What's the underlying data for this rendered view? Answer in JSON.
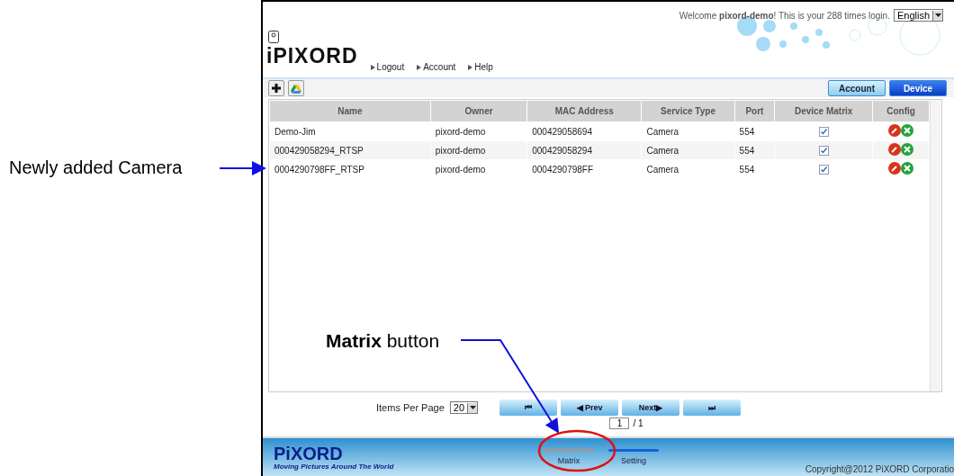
{
  "header": {
    "logo": "iPIXORD",
    "welcome": "Welcome **pixord-demo**! This is your 288 times login.",
    "language": "English",
    "nav_links": [
      "Logout",
      "Account",
      "Help"
    ]
  },
  "toolbar": {
    "tabs": [
      {
        "label": "Account",
        "selected": false
      },
      {
        "label": "Device",
        "selected": true
      }
    ]
  },
  "table": {
    "columns": [
      "Name",
      "Owner",
      "MAC Address",
      "Service Type",
      "Port",
      "Device Matrix",
      "Config"
    ],
    "rows": [
      {
        "cells": [
          "Demo-Jim",
          "pixord-demo",
          "000429058694",
          "Camera",
          "554"
        ],
        "matrix_checked": true
      },
      {
        "cells": [
          "000429058294_RTSP",
          "pixord-demo",
          "000429058294",
          "Camera",
          "554"
        ],
        "matrix_checked": true
      },
      {
        "cells": [
          "0004290798FF_RTSP",
          "pixord-demo",
          "0004290798FF",
          "Camera",
          "554"
        ],
        "matrix_checked": true
      }
    ]
  },
  "pagination": {
    "label": "Items Per Page",
    "per_page": "20",
    "first": "⏮",
    "prev": "◀ Prev",
    "next": "Next▶",
    "last": "⏭",
    "page": "1",
    "total": "/ 1"
  },
  "footer": {
    "logo": "PiXORD",
    "tagline": "Moving Pictures Around The World",
    "tabs": [
      {
        "label": "Matrix",
        "selected": false
      },
      {
        "label": "Setting",
        "selected": true
      }
    ],
    "copyright": "Copyright@2012 PiXORD Corporatio"
  },
  "annotations": [
    {
      "kind": "left",
      "text": "Newly added Camera"
    },
    {
      "kind": "callout",
      "text": "**Matrix** button"
    }
  ]
}
